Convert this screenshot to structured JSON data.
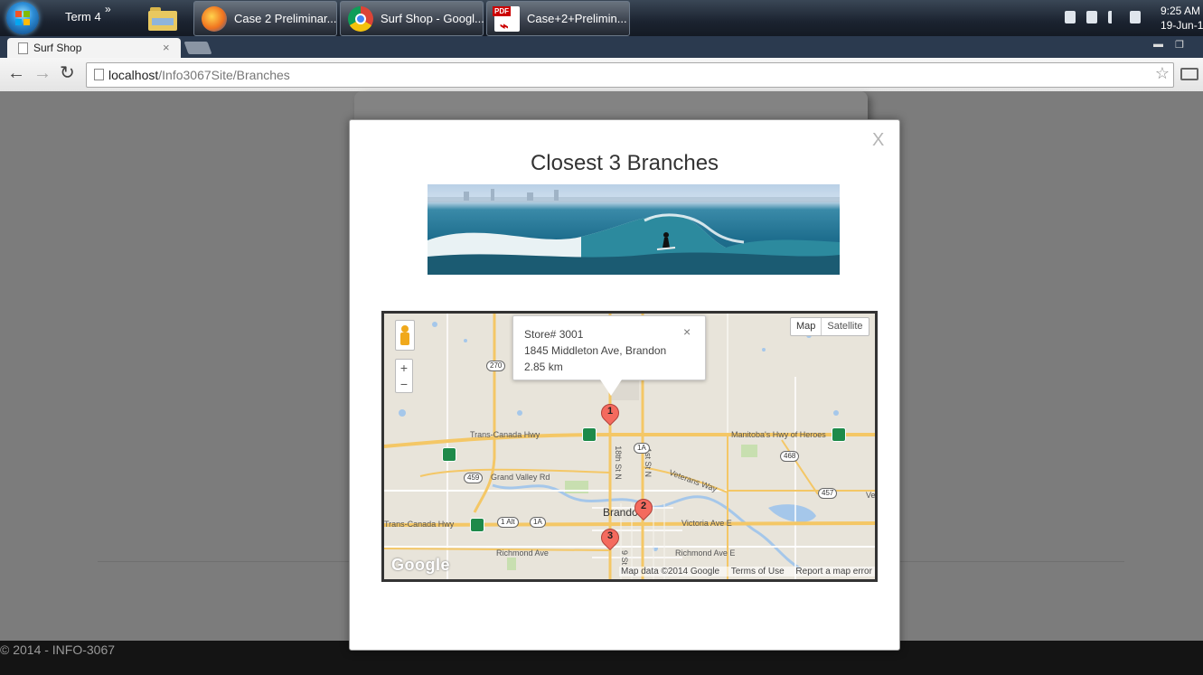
{
  "taskbar": {
    "toolbar_label": "Term 4",
    "more_glyph": "»",
    "buttons": [
      {
        "label": "Case 2 Preliminar...",
        "icon": "firefox-icon"
      },
      {
        "label": "Surf Shop - Googl...",
        "icon": "chrome-icon"
      },
      {
        "label": "Case+2+Prelimin...",
        "icon": "pdf-icon"
      }
    ],
    "pdf_tag": "PDF",
    "clock_time": "9:25 AM",
    "clock_date": "19-Jun-1"
  },
  "browser": {
    "tab_title": "Surf Shop",
    "tab_close": "×",
    "url_host": "localhost",
    "url_path": "/Info3067Site/Branches",
    "back": "←",
    "forward": "→",
    "reload": "↻",
    "star": "☆",
    "min": "▬",
    "restore": "❐"
  },
  "modal": {
    "close_label": "X",
    "title": "Closest 3 Branches"
  },
  "map": {
    "zoom_in": "+",
    "zoom_out": "−",
    "type_map": "Map",
    "type_satellite": "Satellite",
    "info": {
      "store": "Store# 3001",
      "address": "1845 Middleton Ave, Brandon",
      "distance": "2.85 km",
      "close": "×"
    },
    "markers": [
      "1",
      "2",
      "3"
    ],
    "attribution": {
      "data": "Map data ©2014 Google",
      "terms": "Terms of Use",
      "report": "Report a map error"
    },
    "logo": "Google",
    "labels": {
      "tch_left": "Trans-Canada Hwy",
      "tch_bottom": "Trans-Canada Hwy",
      "heroes": "Manitoba's Hwy of Heroes",
      "grand_valley": "Grand Valley Rd",
      "veterans": "Veterans Way",
      "brandon": "Brandon",
      "victoria": "Victoria Ave E",
      "richmond_w": "Richmond Ave",
      "richmond_e": "Richmond Ave E",
      "st18": "18th St N",
      "st1": "1st St N",
      "st9": "9 St",
      "ve": "Ve",
      "h270": "270",
      "h459": "459",
      "h468": "468",
      "h457": "457",
      "h1a": "1A",
      "h1a2": "1A",
      "h1alt": "1 Alt",
      "tc1": "1"
    }
  },
  "page": {
    "copyright": "© 2014 - INFO-3067"
  },
  "colors": {
    "modal_bg": "#ffffff",
    "overlay": "#7c7c7c",
    "marker": "#f46a5e",
    "highway": "#f4c766",
    "water": "#a5c7ea"
  }
}
